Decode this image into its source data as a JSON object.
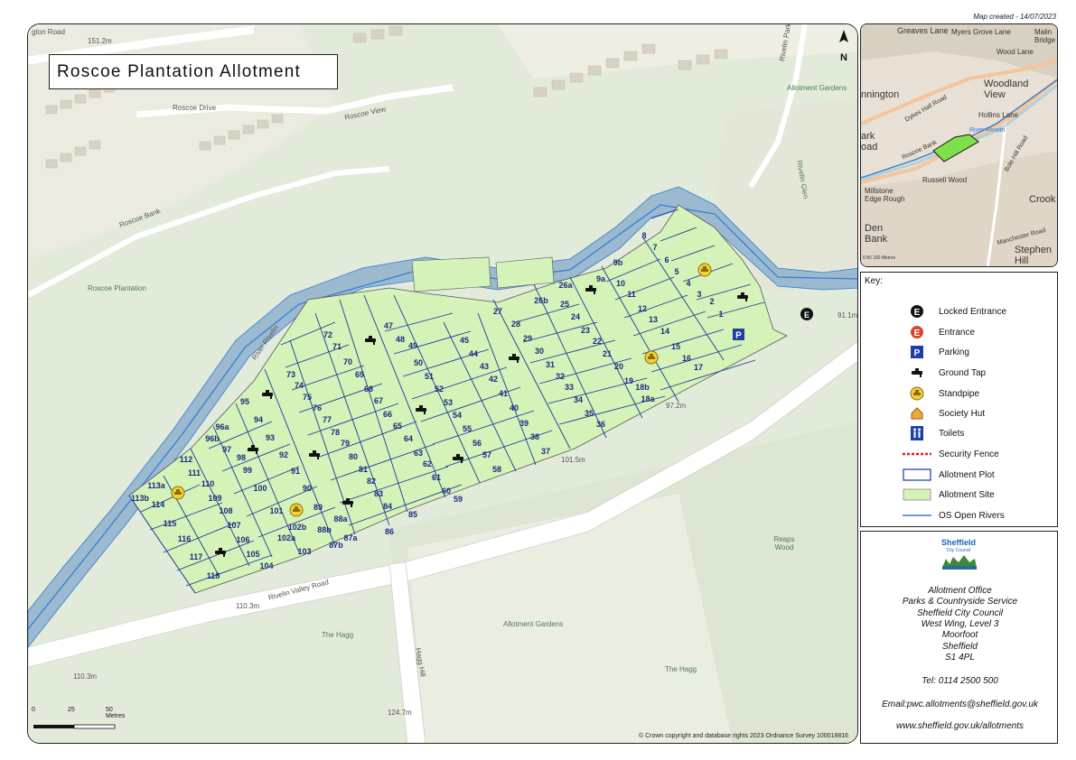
{
  "map_created": "Map created - 14/07/2023",
  "title": "Roscoe Plantation Allotment",
  "north_label": "N",
  "map_labels": [
    {
      "text": "gton Road",
      "style": "grey"
    },
    {
      "text": "151.2m",
      "style": "grey"
    },
    {
      "text": "Roscoe Drive",
      "style": "grey"
    },
    {
      "text": "Roscoe View",
      "style": "grey"
    },
    {
      "text": "Roscoe Bank",
      "style": "grey"
    },
    {
      "text": "Rivelin Park Road",
      "style": "grey"
    },
    {
      "text": "Allotment Gardens",
      "style": "green"
    },
    {
      "text": "Rivelin Glen",
      "style": "green"
    },
    {
      "text": "Roscoe Plantation",
      "style": "green"
    },
    {
      "text": "River Rivelin",
      "style": "grey"
    },
    {
      "text": "91.1m",
      "style": "grey"
    },
    {
      "text": "97.2m",
      "style": "grey"
    },
    {
      "text": "101.5m",
      "style": "grey"
    },
    {
      "text": "110.3m",
      "style": "grey"
    },
    {
      "text": "Rivelin Valley Road",
      "style": "grey"
    },
    {
      "text": "The Hagg",
      "style": "green"
    },
    {
      "text": "Allotment Gardens",
      "style": "green"
    },
    {
      "text": "The Hagg",
      "style": "green"
    },
    {
      "text": "Hagg Hill",
      "style": "grey"
    },
    {
      "text": "124.7m",
      "style": "grey"
    },
    {
      "text": "110.3m",
      "style": "grey"
    },
    {
      "text": "Reaps Wood",
      "style": "green"
    }
  ],
  "plots": [
    "1",
    "2",
    "3",
    "4",
    "5",
    "6",
    "7",
    "8",
    "9a",
    "9b",
    "10",
    "11",
    "12",
    "13",
    "14",
    "15",
    "16",
    "17",
    "18a",
    "18b",
    "19",
    "20",
    "21",
    "22",
    "23",
    "24",
    "25",
    "26a",
    "26b",
    "27",
    "28",
    "29",
    "30",
    "31",
    "32",
    "33",
    "34",
    "35",
    "36",
    "37",
    "38",
    "39",
    "40",
    "41",
    "42",
    "43",
    "44",
    "45",
    "47",
    "48",
    "49",
    "50",
    "51",
    "52",
    "53",
    "54",
    "55",
    "56",
    "57",
    "58",
    "59",
    "60",
    "61",
    "62",
    "63",
    "64",
    "65",
    "66",
    "67",
    "68",
    "69",
    "70",
    "71",
    "72",
    "73",
    "74",
    "75",
    "76",
    "77",
    "78",
    "79",
    "80",
    "81",
    "82",
    "83",
    "84",
    "85",
    "86",
    "87a",
    "87b",
    "88a",
    "88b",
    "89",
    "90",
    "91",
    "92",
    "93",
    "94",
    "95",
    "96a",
    "96b",
    "97",
    "98",
    "99",
    "100",
    "101",
    "102a",
    "102b",
    "103",
    "104",
    "105",
    "106",
    "107",
    "108",
    "109",
    "110",
    "111",
    "112",
    "113a",
    "113b",
    "114",
    "115",
    "116",
    "117",
    "118"
  ],
  "parking_label": "P",
  "entrance_letter": "E",
  "scale": {
    "labels": [
      "0",
      "25",
      "50 Metres"
    ]
  },
  "copyright": "© Crown copyright and database rights 2023 Ordnance Survey 100018816",
  "inset": {
    "labels": [
      "Greaves Lane",
      "Myers Grove Lane",
      "Malin Bridge",
      "Wood Lane",
      "nnington",
      "Woodland View",
      "Hollins Lane",
      "Dykes Hall Road",
      "Roscoe Bank",
      "River Rivelin",
      "Bole Hill Road",
      "ark oad",
      "Russell Wood",
      "Millstone Edge Rough",
      "Den Bank",
      "Stephen Hill",
      "Crook",
      "Manchester Road"
    ],
    "scale": "0  80  160 Metres"
  },
  "key": {
    "title": "Key:",
    "items": [
      {
        "label": "Locked Entrance",
        "icon": "locked-entrance-icon"
      },
      {
        "label": "Entrance",
        "icon": "entrance-icon"
      },
      {
        "label": "Parking",
        "icon": "parking-icon"
      },
      {
        "label": "Ground Tap",
        "icon": "ground-tap-icon"
      },
      {
        "label": "Standpipe",
        "icon": "standpipe-icon"
      },
      {
        "label": "Society Hut",
        "icon": "society-hut-icon"
      },
      {
        "label": "Toilets",
        "icon": "toilets-icon"
      },
      {
        "label": "Security Fence",
        "icon": "security-fence-icon"
      },
      {
        "label": "Allotment Plot",
        "icon": "allotment-plot-icon"
      },
      {
        "label": "Allotment Site",
        "icon": "allotment-site-icon"
      },
      {
        "label": "OS Open Rivers",
        "icon": "os-open-rivers-icon"
      }
    ]
  },
  "logo": {
    "line1": "Sheffield",
    "line2": "City Council"
  },
  "contact": {
    "lines": [
      "Allotment Office",
      "Parks & Countryside Service",
      "Sheffield City Council",
      "West Wing, Level 3",
      "Moorfoot",
      "Sheffield",
      "S1 4PL"
    ],
    "tel": "Tel: 0114 2500 500",
    "email": "Email:pwc.allotments@sheffield.gov.uk",
    "web": "www.sheffield.gov.uk/allotments"
  },
  "colors": {
    "site_fill": "#d5f2b8",
    "plot_outline": "#1a3a9c",
    "river": "#2e7bd6",
    "river_fill": "#8fb3c8",
    "woodland": "#dde8d6",
    "road": "#ffffff",
    "inset_site": "#7fe04a"
  }
}
